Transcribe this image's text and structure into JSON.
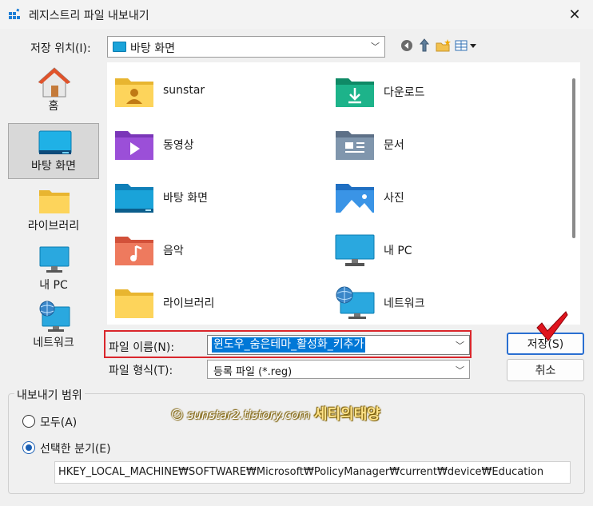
{
  "window": {
    "title": "레지스트리 파일 내보내기"
  },
  "toolbar": {
    "save_in_label": "저장 위치(I):",
    "location": "바탕 화면"
  },
  "places": [
    {
      "label": "홈",
      "icon": "home-icon"
    },
    {
      "label": "바탕 화면",
      "icon": "desktop-icon",
      "selected": true
    },
    {
      "label": "라이브러리",
      "icon": "library-folder-icon"
    },
    {
      "label": "내 PC",
      "icon": "monitor-icon"
    },
    {
      "label": "네트워크",
      "icon": "network-icon"
    }
  ],
  "files": [
    {
      "label": "sunstar",
      "icon": "user-folder-icon"
    },
    {
      "label": "다운로드",
      "icon": "downloads-folder-icon"
    },
    {
      "label": "동영상",
      "icon": "videos-folder-icon"
    },
    {
      "label": "문서",
      "icon": "documents-folder-icon"
    },
    {
      "label": "바탕 화면",
      "icon": "desktop-folder-icon"
    },
    {
      "label": "사진",
      "icon": "pictures-folder-icon"
    },
    {
      "label": "음악",
      "icon": "music-folder-icon"
    },
    {
      "label": "내 PC",
      "icon": "monitor-icon"
    },
    {
      "label": "라이브러리",
      "icon": "library-folder-icon"
    },
    {
      "label": "네트워크",
      "icon": "network-icon"
    }
  ],
  "form": {
    "filename_label": "파일 이름(N):",
    "filename_value": "윈도우_숨은테마_활성화_키추가",
    "filetype_label": "파일 형식(T):",
    "filetype_value": "등록 파일 (*.reg)"
  },
  "buttons": {
    "save": "저장(S)",
    "cancel": "취소"
  },
  "export_range": {
    "label": "내보내기 범위",
    "all_label": "모두(A)",
    "selected_label": "선택한 분기(E)",
    "selected_checked": true,
    "branch_path": "HKEY_LOCAL_MACHINE₩SOFTWARE₩Microsoft₩PolicyManager₩current₩device₩Education"
  },
  "watermark": {
    "url": "sunstar2.tistory.com",
    "name": "세티의태양"
  },
  "colors": {
    "accent": "#0078d7",
    "highlight_border": "#d9262c",
    "checkmark": "#e0141e"
  }
}
